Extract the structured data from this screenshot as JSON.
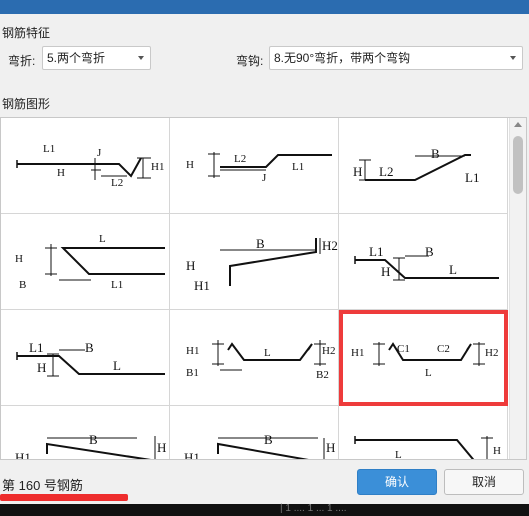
{
  "section_features": "钢筋特征",
  "bend_label": "弯折:",
  "bend_value": "5.两个弯折",
  "hook_label": "弯钩:",
  "hook_value": "8.无90°弯折，带两个弯钩",
  "section_shapes": "钢筋图形",
  "selected_text": "第 160 号钢筋",
  "confirm_label": "确认",
  "cancel_label": "取消",
  "taskbar_fragment": "| 1 .... 1 ... 1 ....",
  "colors": {
    "accent": "#3b8fd8",
    "highlight": "#ee3b3b"
  },
  "shapes": [
    {
      "labels": [
        "L1",
        "J",
        "H1",
        "H",
        "L2"
      ]
    },
    {
      "labels": [
        "H",
        "L2",
        "L1",
        "J"
      ]
    },
    {
      "labels": [
        "B",
        "H",
        "L2",
        "L1"
      ]
    },
    {
      "labels": [
        "L",
        "H",
        "B",
        "L1"
      ]
    },
    {
      "labels": [
        "B",
        "H2",
        "H",
        "H1"
      ]
    },
    {
      "labels": [
        "L1",
        "B",
        "H",
        "L"
      ]
    },
    {
      "labels": [
        "L1",
        "B",
        "H",
        "L"
      ]
    },
    {
      "labels": [
        "H1",
        "L",
        "H2",
        "B1",
        "B2"
      ]
    },
    {
      "labels": [
        "H1",
        "C1",
        "C2",
        "H2",
        "L"
      ]
    },
    {
      "labels": [
        "H1",
        "B",
        "H"
      ]
    },
    {
      "labels": [
        "H1",
        "B",
        "H"
      ]
    },
    {
      "labels": [
        "L",
        "H"
      ]
    }
  ]
}
